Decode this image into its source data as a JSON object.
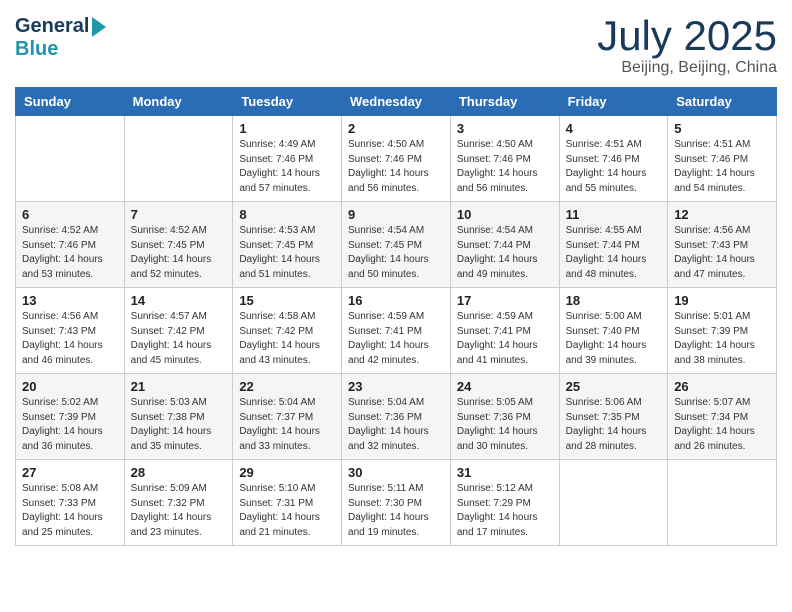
{
  "header": {
    "logo_general": "General",
    "logo_blue": "Blue",
    "month_title": "July 2025",
    "location": "Beijing, Beijing, China"
  },
  "days_of_week": [
    "Sunday",
    "Monday",
    "Tuesday",
    "Wednesday",
    "Thursday",
    "Friday",
    "Saturday"
  ],
  "weeks": [
    [
      {
        "day": "",
        "info": ""
      },
      {
        "day": "",
        "info": ""
      },
      {
        "day": "1",
        "info": "Sunrise: 4:49 AM\nSunset: 7:46 PM\nDaylight: 14 hours\nand 57 minutes."
      },
      {
        "day": "2",
        "info": "Sunrise: 4:50 AM\nSunset: 7:46 PM\nDaylight: 14 hours\nand 56 minutes."
      },
      {
        "day": "3",
        "info": "Sunrise: 4:50 AM\nSunset: 7:46 PM\nDaylight: 14 hours\nand 56 minutes."
      },
      {
        "day": "4",
        "info": "Sunrise: 4:51 AM\nSunset: 7:46 PM\nDaylight: 14 hours\nand 55 minutes."
      },
      {
        "day": "5",
        "info": "Sunrise: 4:51 AM\nSunset: 7:46 PM\nDaylight: 14 hours\nand 54 minutes."
      }
    ],
    [
      {
        "day": "6",
        "info": "Sunrise: 4:52 AM\nSunset: 7:46 PM\nDaylight: 14 hours\nand 53 minutes."
      },
      {
        "day": "7",
        "info": "Sunrise: 4:52 AM\nSunset: 7:45 PM\nDaylight: 14 hours\nand 52 minutes."
      },
      {
        "day": "8",
        "info": "Sunrise: 4:53 AM\nSunset: 7:45 PM\nDaylight: 14 hours\nand 51 minutes."
      },
      {
        "day": "9",
        "info": "Sunrise: 4:54 AM\nSunset: 7:45 PM\nDaylight: 14 hours\nand 50 minutes."
      },
      {
        "day": "10",
        "info": "Sunrise: 4:54 AM\nSunset: 7:44 PM\nDaylight: 14 hours\nand 49 minutes."
      },
      {
        "day": "11",
        "info": "Sunrise: 4:55 AM\nSunset: 7:44 PM\nDaylight: 14 hours\nand 48 minutes."
      },
      {
        "day": "12",
        "info": "Sunrise: 4:56 AM\nSunset: 7:43 PM\nDaylight: 14 hours\nand 47 minutes."
      }
    ],
    [
      {
        "day": "13",
        "info": "Sunrise: 4:56 AM\nSunset: 7:43 PM\nDaylight: 14 hours\nand 46 minutes."
      },
      {
        "day": "14",
        "info": "Sunrise: 4:57 AM\nSunset: 7:42 PM\nDaylight: 14 hours\nand 45 minutes."
      },
      {
        "day": "15",
        "info": "Sunrise: 4:58 AM\nSunset: 7:42 PM\nDaylight: 14 hours\nand 43 minutes."
      },
      {
        "day": "16",
        "info": "Sunrise: 4:59 AM\nSunset: 7:41 PM\nDaylight: 14 hours\nand 42 minutes."
      },
      {
        "day": "17",
        "info": "Sunrise: 4:59 AM\nSunset: 7:41 PM\nDaylight: 14 hours\nand 41 minutes."
      },
      {
        "day": "18",
        "info": "Sunrise: 5:00 AM\nSunset: 7:40 PM\nDaylight: 14 hours\nand 39 minutes."
      },
      {
        "day": "19",
        "info": "Sunrise: 5:01 AM\nSunset: 7:39 PM\nDaylight: 14 hours\nand 38 minutes."
      }
    ],
    [
      {
        "day": "20",
        "info": "Sunrise: 5:02 AM\nSunset: 7:39 PM\nDaylight: 14 hours\nand 36 minutes."
      },
      {
        "day": "21",
        "info": "Sunrise: 5:03 AM\nSunset: 7:38 PM\nDaylight: 14 hours\nand 35 minutes."
      },
      {
        "day": "22",
        "info": "Sunrise: 5:04 AM\nSunset: 7:37 PM\nDaylight: 14 hours\nand 33 minutes."
      },
      {
        "day": "23",
        "info": "Sunrise: 5:04 AM\nSunset: 7:36 PM\nDaylight: 14 hours\nand 32 minutes."
      },
      {
        "day": "24",
        "info": "Sunrise: 5:05 AM\nSunset: 7:36 PM\nDaylight: 14 hours\nand 30 minutes."
      },
      {
        "day": "25",
        "info": "Sunrise: 5:06 AM\nSunset: 7:35 PM\nDaylight: 14 hours\nand 28 minutes."
      },
      {
        "day": "26",
        "info": "Sunrise: 5:07 AM\nSunset: 7:34 PM\nDaylight: 14 hours\nand 26 minutes."
      }
    ],
    [
      {
        "day": "27",
        "info": "Sunrise: 5:08 AM\nSunset: 7:33 PM\nDaylight: 14 hours\nand 25 minutes."
      },
      {
        "day": "28",
        "info": "Sunrise: 5:09 AM\nSunset: 7:32 PM\nDaylight: 14 hours\nand 23 minutes."
      },
      {
        "day": "29",
        "info": "Sunrise: 5:10 AM\nSunset: 7:31 PM\nDaylight: 14 hours\nand 21 minutes."
      },
      {
        "day": "30",
        "info": "Sunrise: 5:11 AM\nSunset: 7:30 PM\nDaylight: 14 hours\nand 19 minutes."
      },
      {
        "day": "31",
        "info": "Sunrise: 5:12 AM\nSunset: 7:29 PM\nDaylight: 14 hours\nand 17 minutes."
      },
      {
        "day": "",
        "info": ""
      },
      {
        "day": "",
        "info": ""
      }
    ]
  ]
}
